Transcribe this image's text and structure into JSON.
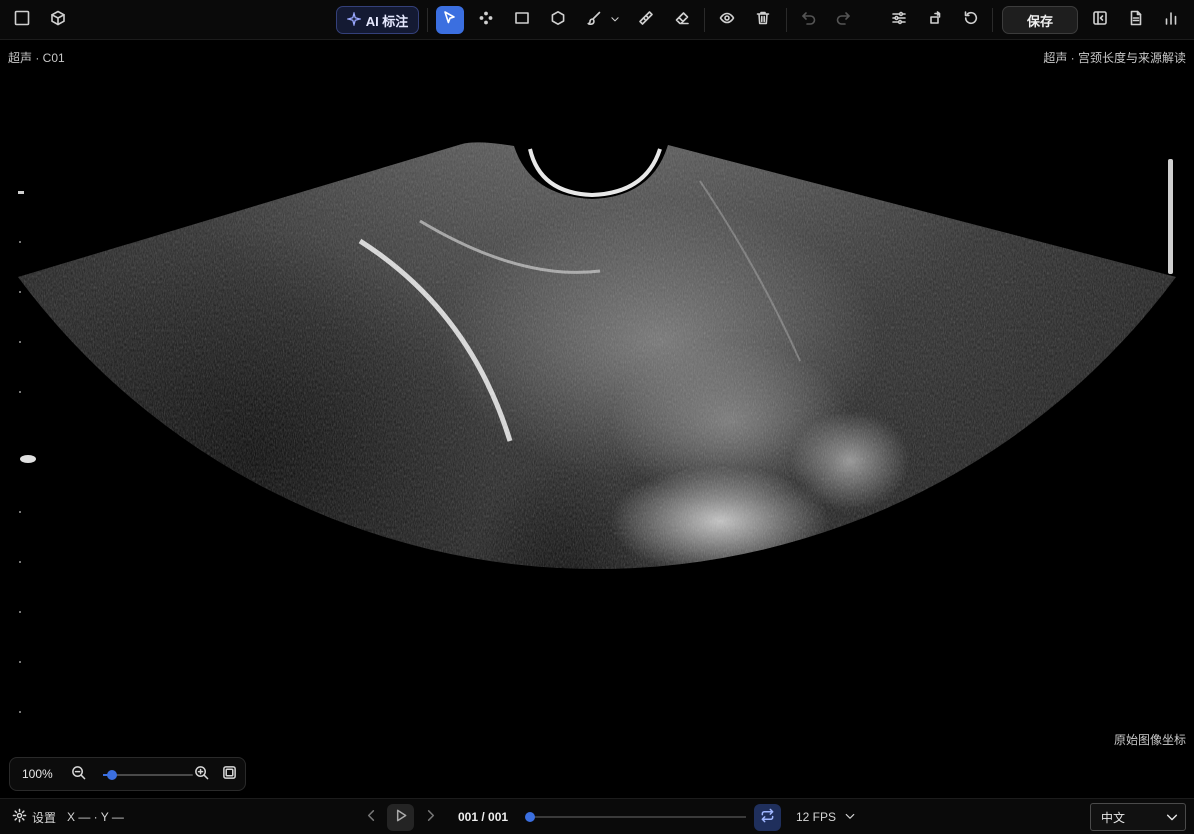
{
  "toolbar": {
    "ai_label": "AI 标注",
    "save_label": "保存"
  },
  "viewer": {
    "top_left": "超声 · C01",
    "top_right": "超声 · 宫颈长度与来源解读",
    "bottom_right": "原始图像坐标"
  },
  "zoom": {
    "percent_label": "100%",
    "slider_fraction": 0.1
  },
  "bottombar": {
    "settings_label": "设置",
    "coords_label": "X — · Y —",
    "frame_label": "001 / 001",
    "frame_fraction": 0,
    "fps_label": "12 FPS",
    "language": "中文"
  },
  "colors": {
    "accent": "#3b6fe0",
    "ai_border": "#34407a",
    "background": "#000000"
  },
  "icons": [
    "square-icon",
    "cube-icon",
    "sparkle-icon",
    "cursor-icon",
    "points-icon",
    "rectangle-icon",
    "polygon-icon",
    "brush-icon",
    "ruler-icon",
    "eraser-icon",
    "eye-icon",
    "trash-icon",
    "undo-icon",
    "redo-icon",
    "sliders-icon",
    "rotate-crop-icon",
    "reset-icon",
    "panel-icon",
    "document-icon",
    "bar-chart-icon"
  ]
}
